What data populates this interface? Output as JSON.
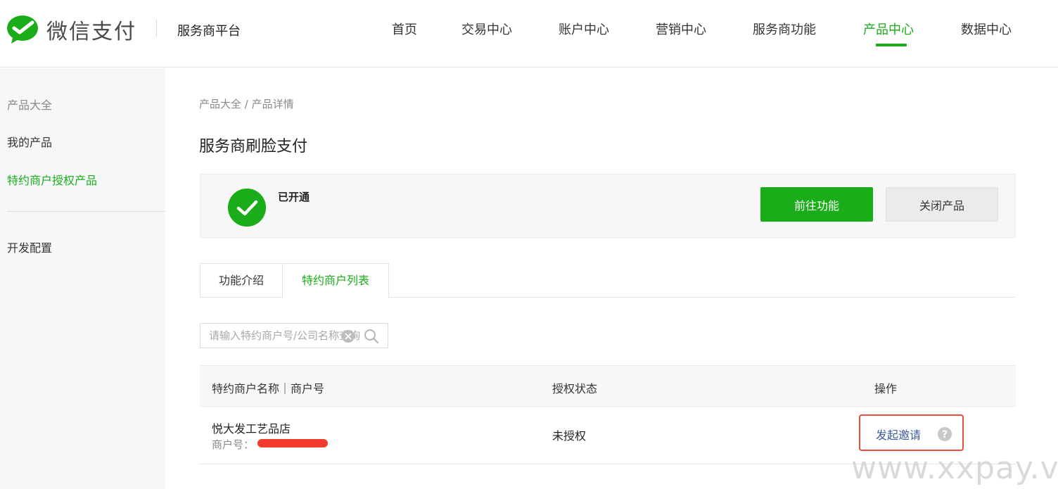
{
  "header": {
    "brand": "微信支付",
    "platform": "服务商平台",
    "nav": [
      {
        "label": "首页"
      },
      {
        "label": "交易中心"
      },
      {
        "label": "账户中心"
      },
      {
        "label": "营销中心"
      },
      {
        "label": "服务商功能"
      },
      {
        "label": "产品中心"
      },
      {
        "label": "数据中心"
      }
    ],
    "active_nav": "产品中心"
  },
  "sidebar": {
    "items": [
      {
        "label": "产品大全"
      },
      {
        "label": "我的产品"
      },
      {
        "label": "特约商户授权产品"
      },
      {
        "label": "开发配置"
      }
    ],
    "active_item": "特约商户授权产品"
  },
  "breadcrumb": "产品大全 / 产品详情",
  "page_title": "服务商刷脸支付",
  "status_card": {
    "status_text": "已开通",
    "primary_button": "前往功能",
    "secondary_button": "关闭产品"
  },
  "tabs": [
    {
      "label": "功能介绍"
    },
    {
      "label": "特约商户列表"
    }
  ],
  "active_tab": "特约商户列表",
  "search": {
    "placeholder": "请输入特约商户号/公司名称查询"
  },
  "table": {
    "columns": [
      "特约商户名称｜商户号",
      "授权状态",
      "操作"
    ],
    "rows": [
      {
        "name": "悦大发工艺品店",
        "id_label": "商户号：",
        "status": "未授权",
        "action": "发起邀请"
      }
    ]
  },
  "watermark": "www.xxpay.vip",
  "colors": {
    "brand_green": "#1aad19",
    "link_blue": "#3d5d99",
    "highlight_red": "#e94d3b"
  }
}
